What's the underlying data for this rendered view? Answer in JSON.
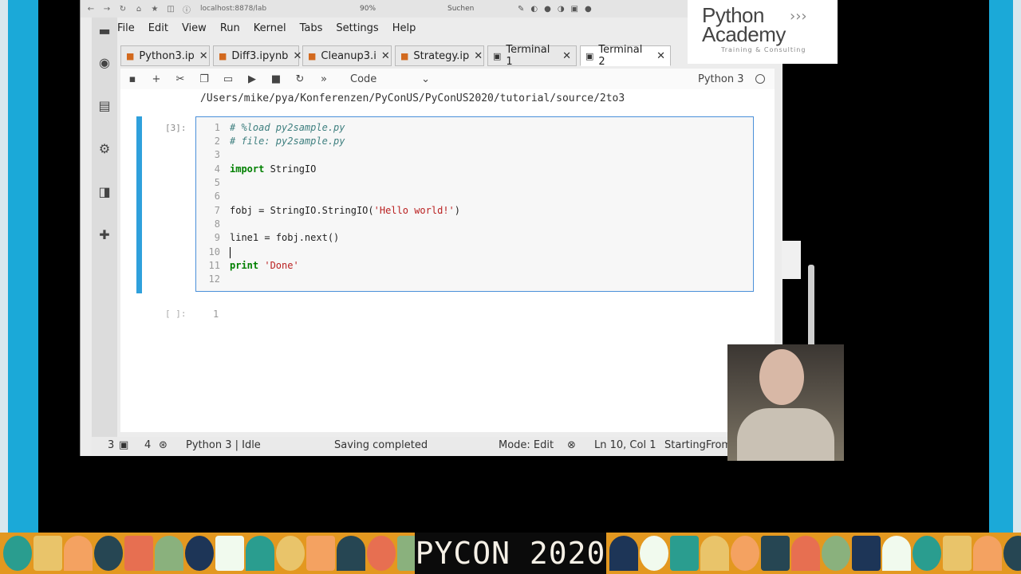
{
  "browser": {
    "url": "localhost:8878/lab",
    "zoom": "90%",
    "search_placeholder": "Suchen"
  },
  "menu": [
    "File",
    "Edit",
    "View",
    "Run",
    "Kernel",
    "Tabs",
    "Settings",
    "Help"
  ],
  "tabs": [
    {
      "label": "Python3.ip",
      "icon": "notebook-icon",
      "active": false
    },
    {
      "label": "Diff3.ipynb",
      "icon": "notebook-icon",
      "active": false
    },
    {
      "label": "Cleanup3.i",
      "icon": "notebook-icon",
      "active": false
    },
    {
      "label": "Strategy.ip",
      "icon": "notebook-icon",
      "active": false
    },
    {
      "label": "Terminal 1",
      "icon": "terminal-icon",
      "active": false
    },
    {
      "label": "Terminal 2",
      "icon": "terminal-icon",
      "active": true
    }
  ],
  "toolbar": {
    "cell_type": "Code",
    "kernel_name": "Python 3"
  },
  "notebook": {
    "path": "/Users/mike/pya/Konferenzen/PyConUS/PyConUS2020/tutorial/source/2to3",
    "cell_prompt": "[3]:",
    "empty_prompt": "[ ]:",
    "empty_line_number": "1",
    "lines": [
      {
        "n": "1",
        "text": "# %load py2sample.py"
      },
      {
        "n": "2",
        "text": "# file: py2sample.py"
      },
      {
        "n": "3",
        "text": ""
      },
      {
        "n": "4",
        "text": "import StringIO"
      },
      {
        "n": "5",
        "text": ""
      },
      {
        "n": "6",
        "text": ""
      },
      {
        "n": "7",
        "text": "fobj = StringIO.StringIO('Hello world!')"
      },
      {
        "n": "8",
        "text": ""
      },
      {
        "n": "9",
        "text": "line1 = fobj.next()"
      },
      {
        "n": "10",
        "text": ""
      },
      {
        "n": "11",
        "text": "print 'Done'"
      },
      {
        "n": "12",
        "text": ""
      }
    ]
  },
  "status": {
    "count_a": "3",
    "count_b": "4",
    "kernel_state": "Python 3 | Idle",
    "save_state": "Saving completed",
    "mode": "Mode: Edit",
    "position": "Ln 10, Col 1",
    "file": "StartingFrom"
  },
  "logo": {
    "line1": "Python",
    "line2": "Academy",
    "arrows": "›››",
    "tagline": "Training & Consulting"
  },
  "banner": {
    "title": "PYCON 2020"
  }
}
